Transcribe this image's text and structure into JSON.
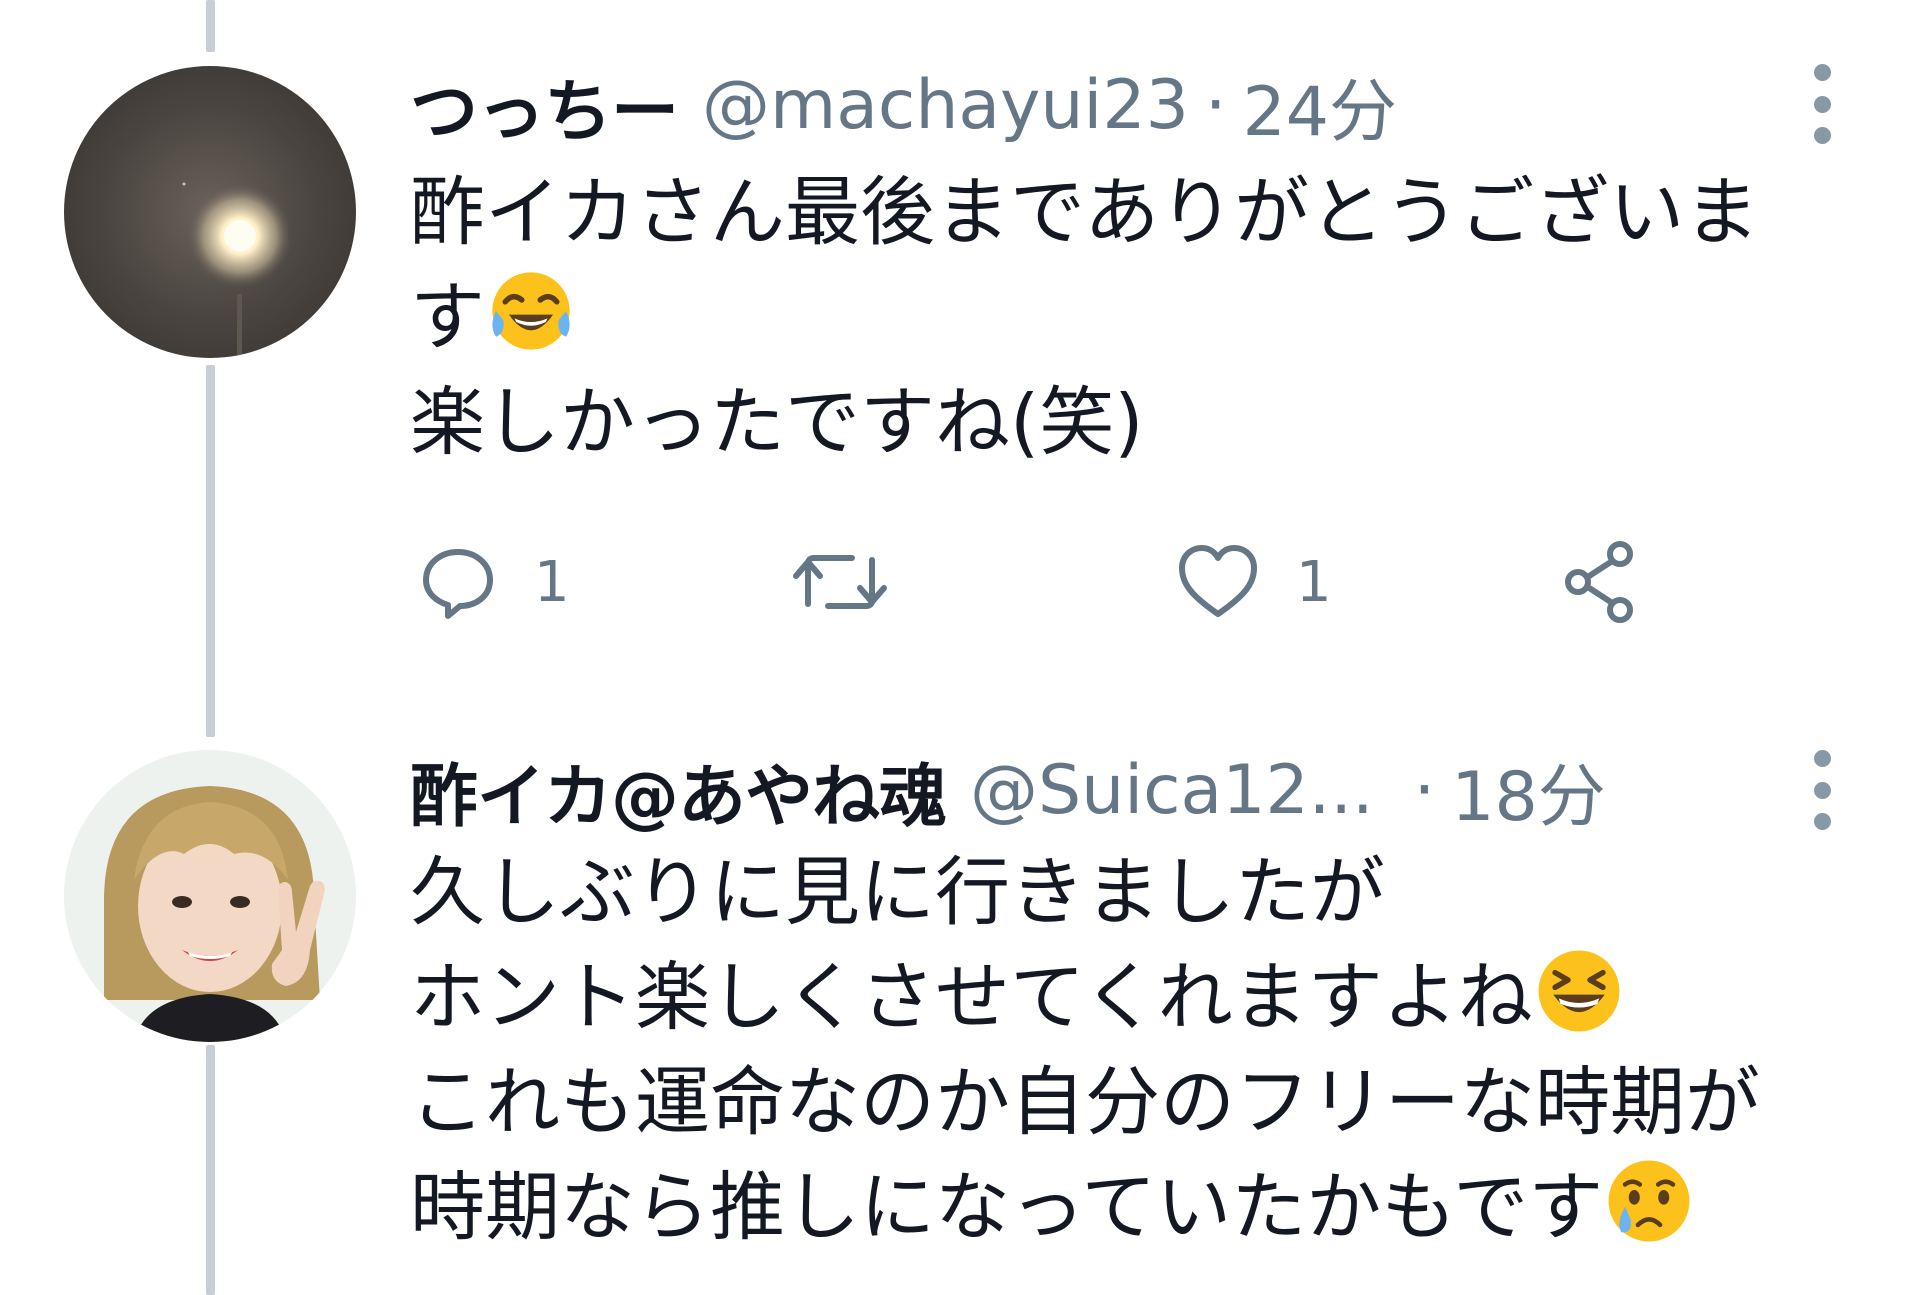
{
  "colors": {
    "text": "#141823",
    "secondary": "#657786",
    "icon": "#8899a6",
    "thread_line": "#c7ced6"
  },
  "tweets": [
    {
      "display_name": "つっちー",
      "handle": "@machayui23",
      "separator": "·",
      "time": "24分",
      "avatar": "night-moon-photo",
      "body_lines": [
        "酢イカさん最後までありがとうございま",
        "す",
        "楽しかったですね(笑)"
      ],
      "emoji": "face-with-tears-of-joy",
      "actions": {
        "reply_count": "1",
        "retweet_count": "",
        "like_count": "1"
      }
    },
    {
      "display_name": "酢イカ@あやね魂",
      "handle": "@Suica12...",
      "separator": "·",
      "time": "18分",
      "avatar": "blonde-girl-peace-sign-photo",
      "body_lines": [
        "久しぶりに見に行きましたが",
        "ホント楽しくさせてくれますよね",
        "これも運命なのか自分のフリーな時期が",
        "時期なら推しになっていたかもです"
      ],
      "emojis": [
        "grinning-squinting-face",
        "crying-face"
      ]
    }
  ]
}
